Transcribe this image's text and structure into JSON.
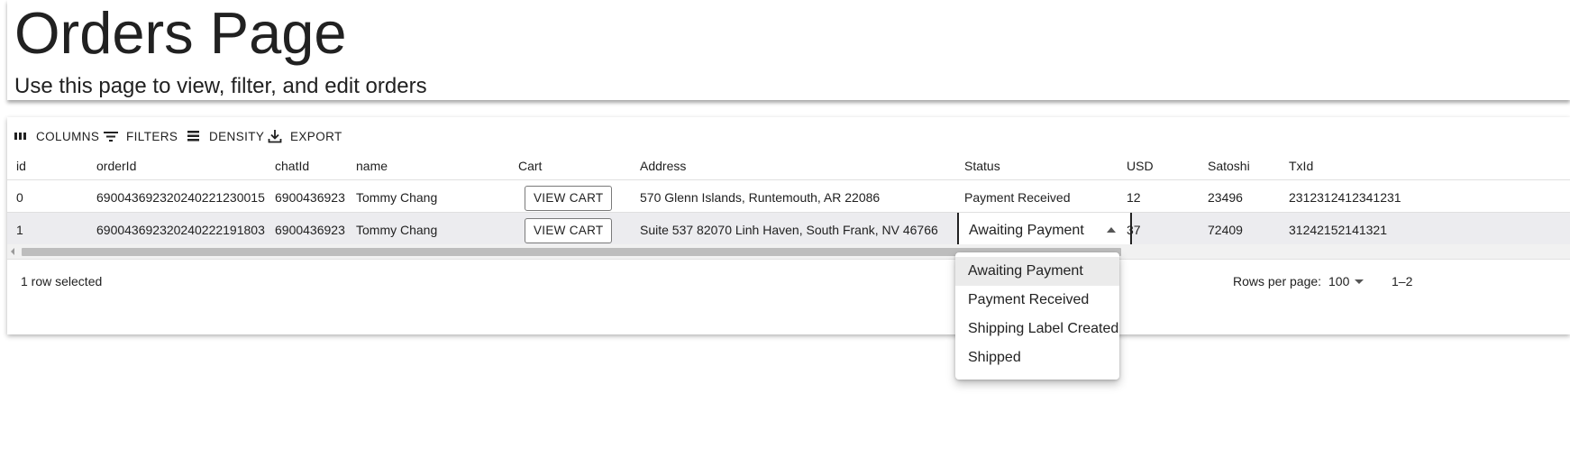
{
  "page": {
    "title": "Orders Page",
    "subtitle": "Use this page to view, filter, and edit orders"
  },
  "toolbar": {
    "columns_label": "COLUMNS",
    "filters_label": "FILTERS",
    "density_label": "DENSITY",
    "export_label": "EXPORT"
  },
  "columns": [
    "id",
    "orderId",
    "chatId",
    "name",
    "Cart",
    "Address",
    "Status",
    "USD",
    "Satoshi",
    "TxId"
  ],
  "rows": [
    {
      "id": "0",
      "orderId": "690043692320240221230015",
      "chatId": "6900436923",
      "name": "Tommy Chang",
      "cart": "VIEW CART",
      "address": "570 Glenn Islands, Runtemouth, AR 22086",
      "status": "Payment Received",
      "usd": "12",
      "satoshi": "23496",
      "txid": "2312312412341231"
    },
    {
      "id": "1",
      "orderId": "690043692320240222191803",
      "chatId": "6900436923",
      "name": "Tommy Chang",
      "cart": "VIEW CART",
      "address": "Suite 537 82070 Linh Haven, South Frank, NV 46766",
      "status": "Awaiting Payment",
      "usd": "37",
      "satoshi": "72409",
      "txid": "31242152141321"
    }
  ],
  "footer": {
    "selection": "1 row selected",
    "rows_per_page_label": "Rows per page:",
    "rows_per_page_value": "100",
    "range": "1–2"
  },
  "status_menu": {
    "options": [
      "Awaiting Payment",
      "Payment Received",
      "Shipping Label Created",
      "Shipped"
    ],
    "selected": "Awaiting Payment"
  }
}
